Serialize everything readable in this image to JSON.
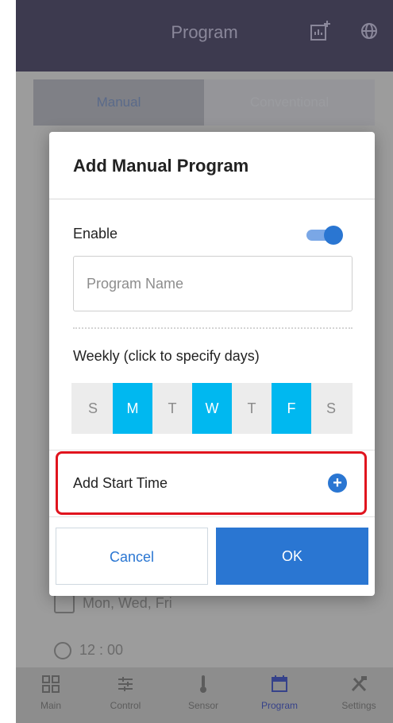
{
  "header": {
    "title": "Program"
  },
  "tabs": [
    {
      "label": "Manual"
    },
    {
      "label": "Conventional"
    }
  ],
  "background_program": {
    "days_text": "Mon, Wed, Fri",
    "time_text": "12 : 00"
  },
  "dialog": {
    "title": "Add Manual Program",
    "enable_label": "Enable",
    "enabled": true,
    "name_placeholder": "Program Name",
    "name_value": "",
    "weekly_label": "Weekly (click to specify days)",
    "days": [
      {
        "label": "S",
        "selected": false
      },
      {
        "label": "M",
        "selected": true
      },
      {
        "label": "T",
        "selected": false
      },
      {
        "label": "W",
        "selected": true
      },
      {
        "label": "T",
        "selected": false
      },
      {
        "label": "F",
        "selected": true
      },
      {
        "label": "S",
        "selected": false
      }
    ],
    "add_start_time_label": "Add Start Time",
    "add_icon": "plus-circle-icon",
    "cancel_label": "Cancel",
    "ok_label": "OK"
  },
  "nav": [
    {
      "label": "Main",
      "icon": "grid-icon"
    },
    {
      "label": "Control",
      "icon": "sliders-icon"
    },
    {
      "label": "Sensor",
      "icon": "thermometer-icon"
    },
    {
      "label": "Program",
      "icon": "calendar-icon",
      "active": true
    },
    {
      "label": "Settings",
      "icon": "tools-icon"
    }
  ],
  "colors": {
    "header_bg": "#3d3a4f",
    "accent_blue": "#2a76d2",
    "day_selected": "#00b8f0",
    "highlight_red": "#e0141e"
  }
}
